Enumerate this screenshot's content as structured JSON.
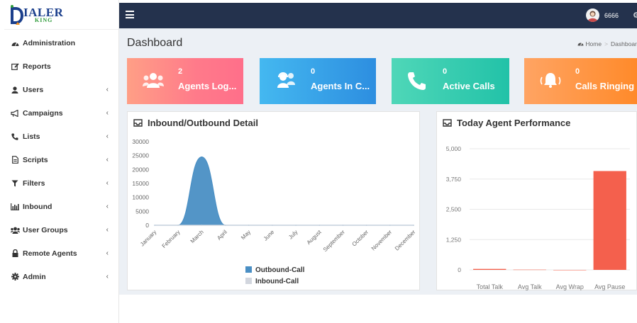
{
  "app": {
    "logo_big": "IALER",
    "logo_small": "KING"
  },
  "sidebar": {
    "items": [
      {
        "label": "Administration",
        "icon": "dashboard-icon",
        "has_chevron": false
      },
      {
        "label": "Reports",
        "icon": "edit-icon",
        "has_chevron": false
      },
      {
        "label": "Users",
        "icon": "user-icon",
        "has_chevron": true
      },
      {
        "label": "Campaigns",
        "icon": "megaphone-icon",
        "has_chevron": true
      },
      {
        "label": "Lists",
        "icon": "phone-icon",
        "has_chevron": true
      },
      {
        "label": "Scripts",
        "icon": "file-icon",
        "has_chevron": true
      },
      {
        "label": "Filters",
        "icon": "filter-icon",
        "has_chevron": true
      },
      {
        "label": "Inbound",
        "icon": "bar-chart-icon",
        "has_chevron": true
      },
      {
        "label": "User Groups",
        "icon": "users-icon",
        "has_chevron": true
      },
      {
        "label": "Remote Agents",
        "icon": "lock-icon",
        "has_chevron": true
      },
      {
        "label": "Admin",
        "icon": "gear-icon",
        "has_chevron": true
      }
    ],
    "chevron": "‹"
  },
  "topbar": {
    "user_name": "6666"
  },
  "page": {
    "title": "Dashboard",
    "breadcrumb_home": "Home",
    "breadcrumb_current": "Dashboard"
  },
  "cards": [
    {
      "value": "2",
      "label": "Agents Log...",
      "icon": "users-icon",
      "color": "#ff7a8a"
    },
    {
      "value": "0",
      "label": "Agents In C...",
      "icon": "headset-users-icon",
      "color": "#2d8ee0"
    },
    {
      "value": "0",
      "label": "Active Calls",
      "icon": "phone-icon",
      "color": "#22c2a8"
    },
    {
      "value": "0",
      "label": "Calls Ringing",
      "icon": "bell-icon",
      "color": "#ff8a2a"
    }
  ],
  "panels": {
    "inout_title": "Inbound/Outbound Detail",
    "perf_title": "Today Agent Performance"
  },
  "chart_data": [
    {
      "type": "area",
      "categories": [
        "January",
        "February",
        "March",
        "April",
        "May",
        "June",
        "July",
        "August",
        "September",
        "October",
        "November",
        "December"
      ],
      "series": [
        {
          "name": "Outbound-Call",
          "color": "#4a8fc4",
          "values": [
            0,
            0,
            24500,
            0,
            0,
            0,
            0,
            0,
            0,
            0,
            0,
            0
          ]
        },
        {
          "name": "Inbound-Call",
          "color": "#d2d6de",
          "values": [
            0,
            0,
            0,
            0,
            0,
            0,
            0,
            0,
            0,
            0,
            0,
            0
          ]
        }
      ],
      "ylim": [
        0,
        30000
      ],
      "yticks": [
        "30000",
        "25000",
        "20000",
        "15000",
        "10000",
        "5000",
        "0"
      ],
      "legend": "bottom"
    },
    {
      "type": "bar",
      "categories": [
        "Total Talk",
        "Avg Talk",
        "Avg Wrap",
        "Avg Pause"
      ],
      "values": [
        40,
        10,
        0,
        4080
      ],
      "color": "#f4604d",
      "ylim": [
        0,
        5000
      ],
      "yticks": [
        "5,000",
        "3,750",
        "2,500",
        "1,250",
        "0"
      ],
      "grid": true
    }
  ]
}
